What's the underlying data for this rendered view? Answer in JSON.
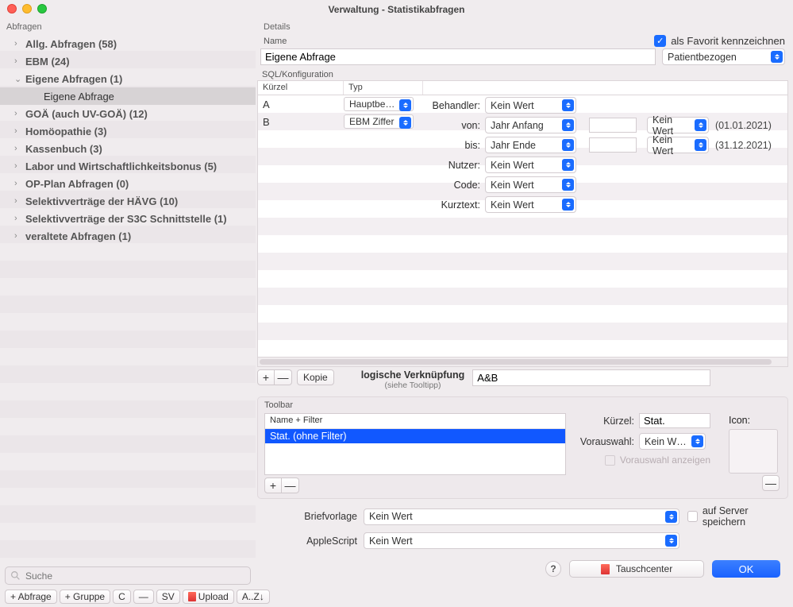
{
  "window": {
    "title": "Verwaltung - Statistikabfragen"
  },
  "sidebar": {
    "header": "Abfragen",
    "search_placeholder": "Suche",
    "nodes": [
      {
        "label": "Allg. Abfragen (58)",
        "expanded": false
      },
      {
        "label": "EBM (24)",
        "expanded": false
      },
      {
        "label": "Eigene Abfragen (1)",
        "expanded": true,
        "children": [
          {
            "label": "Eigene Abfrage",
            "selected": true
          }
        ]
      },
      {
        "label": "GOÄ (auch UV-GOÄ) (12)",
        "expanded": false
      },
      {
        "label": "Homöopathie (3)",
        "expanded": false
      },
      {
        "label": "Kassenbuch (3)",
        "expanded": false
      },
      {
        "label": "Labor und Wirtschaftlichkeitsbonus (5)",
        "expanded": false
      },
      {
        "label": "OP-Plan Abfragen (0)",
        "expanded": false
      },
      {
        "label": "Selektivverträge der HÄVG (10)",
        "expanded": false
      },
      {
        "label": "Selektivverträge der S3C Schnittstelle (1)",
        "expanded": false
      },
      {
        "label": "veraltete Abfragen (1)",
        "expanded": false
      }
    ],
    "buttons": {
      "add_query": "+ Abfrage",
      "add_group": "+ Gruppe",
      "c": "C",
      "minus": "—",
      "sv": "SV",
      "upload": "Upload",
      "sort": "A..Z↓"
    }
  },
  "details": {
    "header": "Details",
    "name_label": "Name",
    "favorite_label": "als Favorit kennzeichnen",
    "favorite_checked": true,
    "name_value": "Eigene Abfrage",
    "scope_value": "Patientbezogen",
    "sql_label": "SQL/Konfiguration",
    "table": {
      "col_k": "Kürzel",
      "col_t": "Typ",
      "rows": [
        {
          "k": "A",
          "t": "Hauptbe…"
        },
        {
          "k": "B",
          "t": "EBM Ziffer"
        }
      ]
    },
    "filters": {
      "behandler_lab": "Behandler:",
      "behandler_val": "Kein Wert",
      "von_lab": "von:",
      "von_val": "Jahr Anfang",
      "von_right": "Kein Wert",
      "von_date": "(01.01.2021)",
      "bis_lab": "bis:",
      "bis_val": "Jahr Ende",
      "bis_right": "Kein Wert",
      "bis_date": "(31.12.2021)",
      "nutzer_lab": "Nutzer:",
      "nutzer_val": "Kein Wert",
      "code_lab": "Code:",
      "code_val": "Kein Wert",
      "kurztext_lab": "Kurztext:",
      "kurztext_val": "Kein Wert"
    },
    "sql_toolbar": {
      "plus": "+",
      "minus": "—",
      "kopie": "Kopie",
      "lv_label": "logische Verknüpfung",
      "lv_sub": "(siehe Tooltipp)",
      "lv_value": "A&B"
    },
    "toolbar_box": {
      "title": "Toolbar",
      "list_header": "Name + Filter",
      "list_item": "Stat. (ohne Filter)",
      "kuerzel_lab": "Kürzel:",
      "kuerzel_val": "Stat.",
      "vorauswahl_lab": "Vorauswahl:",
      "vorauswahl_val": "Kein W…",
      "vorauswahl_show": "Vorauswahl anzeigen",
      "icon_lab": "Icon:",
      "plus": "+",
      "minus": "—"
    },
    "bottom": {
      "briefvorlage_lab": "Briefvorlage",
      "briefvorlage_val": "Kein Wert",
      "applescript_lab": "AppleScript",
      "applescript_val": "Kein Wert",
      "server_lab": "auf Server speichern"
    }
  },
  "footer": {
    "tauschcenter": "Tauschcenter",
    "ok": "OK"
  }
}
